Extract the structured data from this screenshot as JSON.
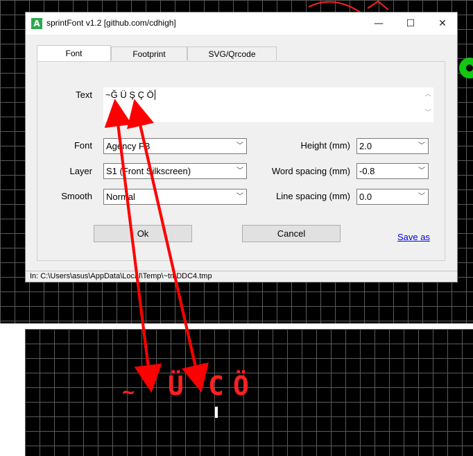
{
  "window": {
    "title": "sprintFont v1.2 [github.com/cdhigh]",
    "minimize": "—",
    "maximize": "☐",
    "close": "✕"
  },
  "tabs": [
    {
      "label": "Font",
      "active": true
    },
    {
      "label": "Footprint",
      "active": false
    },
    {
      "label": "SVG/Qrcode",
      "active": false
    }
  ],
  "form": {
    "text_label": "Text",
    "text_value": "~Ğ Ü Ş Ç Ö",
    "font_label": "Font",
    "font_value": "Agency FB",
    "layer_label": "Layer",
    "layer_value": "S1 (Front Silkscreen)",
    "smooth_label": "Smooth",
    "smooth_value": "Normal",
    "height_label": "Height (mm)",
    "height_value": "2.0",
    "word_spacing_label": "Word spacing (mm)",
    "word_spacing_value": "-0.8",
    "line_spacing_label": "Line spacing (mm)",
    "line_spacing_value": "0.0"
  },
  "buttons": {
    "ok": "Ok",
    "cancel": "Cancel",
    "save_as": "Save as"
  },
  "status": "In: C:\\Users\\asus\\AppData\\Local\\Temp\\~tmDDC4.tmp",
  "pcb_render": {
    "tilde": "~",
    "u": "Ü",
    "c": "C",
    "o": "Ö"
  },
  "colors": {
    "annotation_arrow": "#ff0000",
    "pcb_text": "#ff2020",
    "pad": "#11c811"
  }
}
